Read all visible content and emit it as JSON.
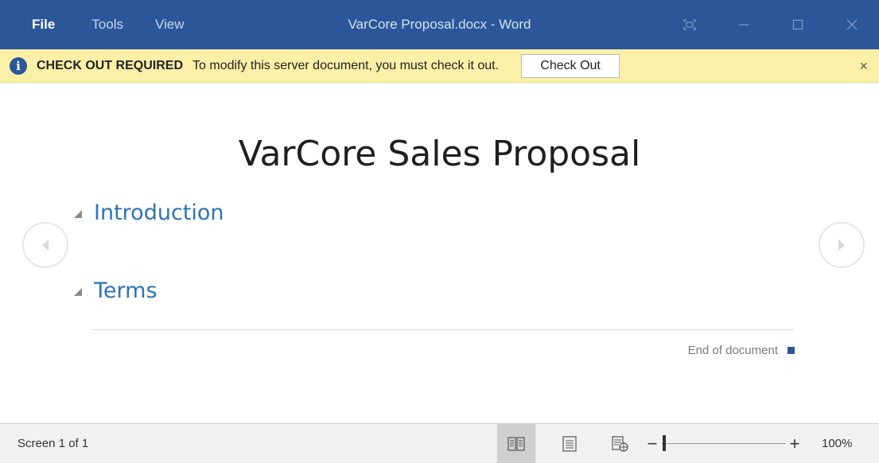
{
  "window": {
    "title": "VarCore Proposal.docx - Word",
    "menu": [
      "File",
      "Tools",
      "View"
    ]
  },
  "message_bar": {
    "title": "CHECK OUT REQUIRED",
    "text": "To modify this server document, you must check it out.",
    "button_label": "Check Out",
    "close_glyph": "×"
  },
  "document": {
    "heading": "VarCore Sales Proposal",
    "sections": [
      "Introduction",
      "Terms"
    ],
    "end_text": "End of document"
  },
  "status_bar": {
    "page_info": "Screen 1 of 1",
    "zoom_minus": "−",
    "zoom_plus": "+",
    "zoom_level": "100%",
    "zoom_fraction": 0.02
  },
  "colors": {
    "title_bar": "#2b579a",
    "message_bar": "#fcf0a8",
    "section_heading": "#2e74b5",
    "status_bar": "#f1f1f1"
  },
  "icons": {
    "info": "info-icon",
    "restore_down": "fullscreen-icon",
    "minimize": "minimize-icon",
    "maximize": "maximize-icon",
    "close": "close-icon",
    "previous": "chevron-left-icon",
    "next": "chevron-right-icon",
    "read_mode": "read-mode-icon",
    "print_layout": "print-layout-icon",
    "web_layout": "web-layout-icon"
  }
}
